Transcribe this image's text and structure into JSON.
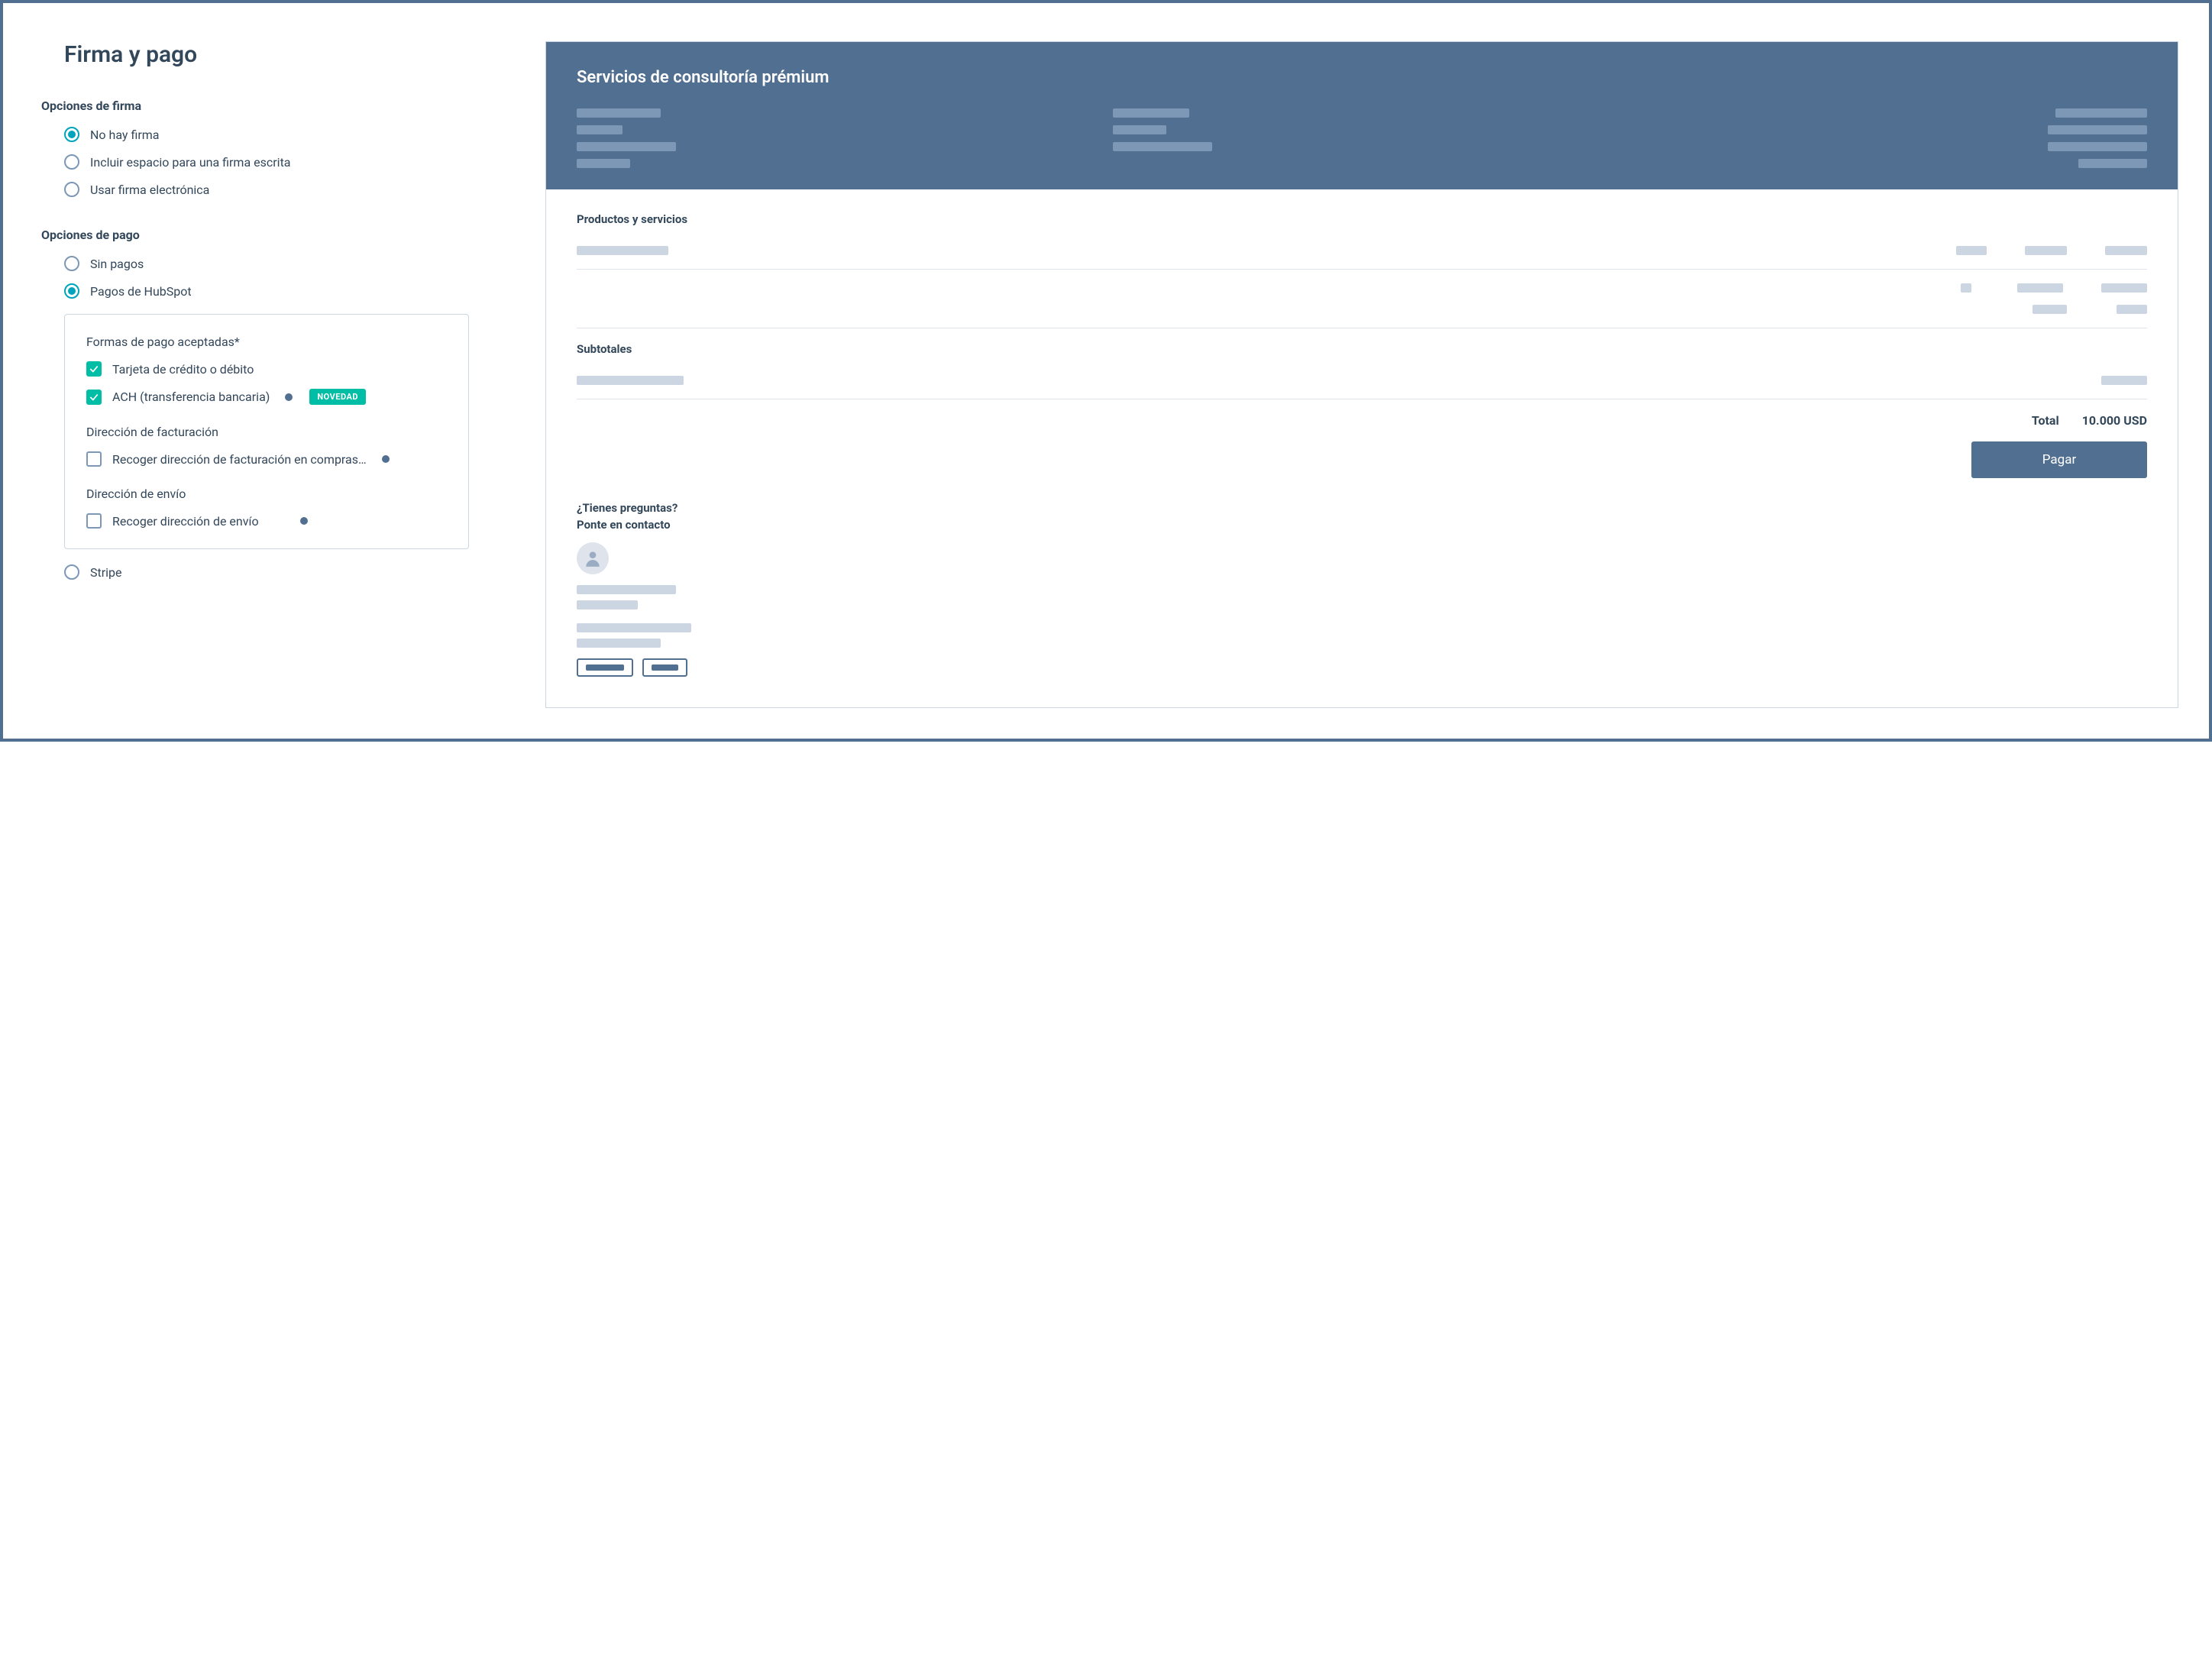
{
  "pageTitle": "Firma y pago",
  "signature": {
    "heading": "Opciones de firma",
    "options": [
      {
        "label": "No hay firma",
        "checked": true
      },
      {
        "label": "Incluir espacio para una firma escrita",
        "checked": false
      },
      {
        "label": "Usar firma electrónica",
        "checked": false
      }
    ]
  },
  "payment": {
    "heading": "Opciones de pago",
    "options": [
      {
        "label": "Sin pagos",
        "checked": false
      },
      {
        "label": "Pagos de HubSpot",
        "checked": true
      },
      {
        "label": "Stripe",
        "checked": false
      }
    ]
  },
  "acceptedForms": {
    "heading": "Formas de pago aceptadas*",
    "items": [
      {
        "label": "Tarjeta de crédito o débito",
        "checked": true,
        "badge": ""
      },
      {
        "label": "ACH (transferencia bancaria)",
        "checked": true,
        "badge": "NOVEDAD"
      }
    ]
  },
  "billing": {
    "heading": "Dirección de facturación",
    "checkboxLabel": "Recoger dirección de facturación en compras…"
  },
  "shipping": {
    "heading": "Dirección de envío",
    "checkboxLabel": "Recoger dirección de envío"
  },
  "preview": {
    "title": "Servicios de consultoría prémium",
    "productsHeading": "Productos y servicios",
    "subtotalsHeading": "Subtotales",
    "totalLabel": "Total",
    "totalValue": "10.000 USD",
    "payLabel": "Pagar",
    "questionsHeading": "¿Tienes preguntas?",
    "contactHeading": "Ponte en contacto"
  }
}
